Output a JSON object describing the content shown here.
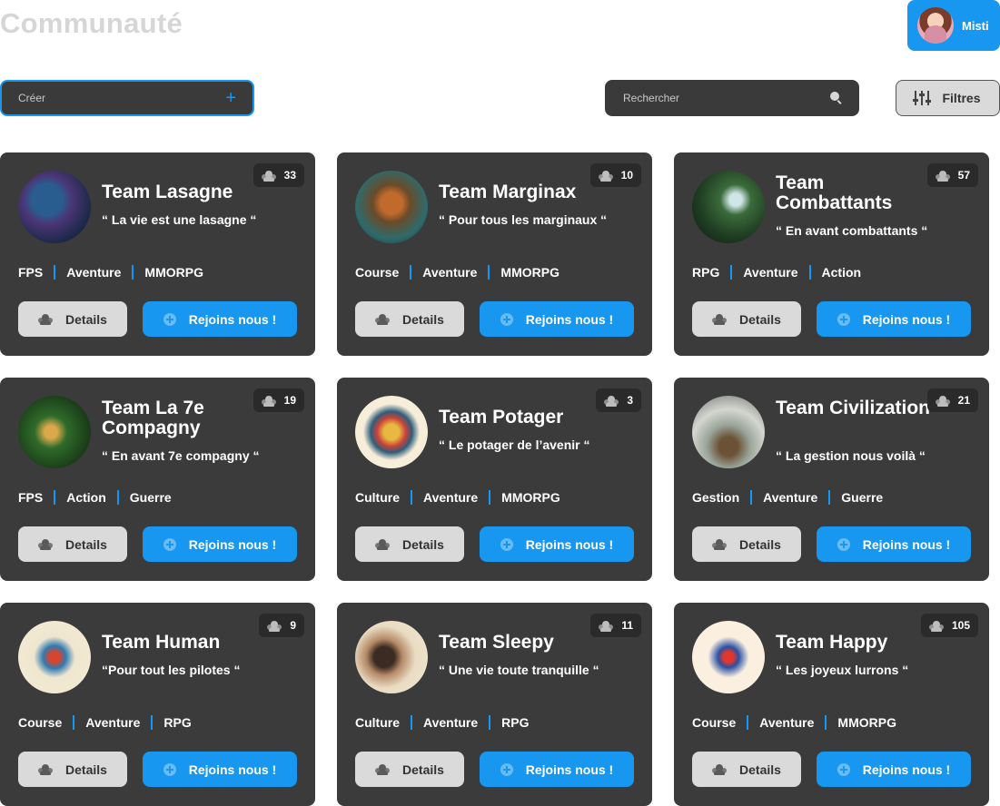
{
  "header": {
    "title": "Communauté"
  },
  "user": {
    "name": "Misti"
  },
  "toolbar": {
    "create_label": "Créer",
    "search_placeholder": "Rechercher",
    "filters_label": "Filtres"
  },
  "card_actions": {
    "details_label": "Details",
    "join_label": "Rejoins nous !"
  },
  "teams": [
    {
      "name": "Team Lasagne",
      "quote": "“ La vie est une lasagne “",
      "members": "33",
      "tags": [
        "FPS",
        "Aventure",
        "MMORPG"
      ]
    },
    {
      "name": "Team Marginax",
      "quote": "“ Pour tous les marginaux “",
      "members": "10",
      "tags": [
        "Course",
        "Aventure",
        "MMORPG"
      ]
    },
    {
      "name": "Team Combattants",
      "quote": "“ En avant combattants “",
      "members": "57",
      "tags": [
        "RPG",
        "Aventure",
        "Action"
      ]
    },
    {
      "name": "Team La 7e Compagny",
      "quote": "“ En avant 7e compagny “",
      "members": "19",
      "tags": [
        "FPS",
        "Action",
        "Guerre"
      ]
    },
    {
      "name": "Team Potager",
      "quote": "“ Le potager de l’avenir “",
      "members": "3",
      "tags": [
        "Culture",
        "Aventure",
        "MMORPG"
      ]
    },
    {
      "name": "Team Civilization",
      "quote": "“ La gestion nous voilà “",
      "members": "21",
      "tags": [
        "Gestion",
        "Aventure",
        "Guerre"
      ]
    },
    {
      "name": "Team Human",
      "quote": "“Pour tout les pilotes “",
      "members": "9",
      "tags": [
        "Course",
        "Aventure",
        "RPG"
      ]
    },
    {
      "name": "Team Sleepy",
      "quote": "“ Une vie toute tranquille “",
      "members": "11",
      "tags": [
        "Culture",
        "Aventure",
        "RPG"
      ]
    },
    {
      "name": "Team Happy",
      "quote": "“ Les joyeux lurrons “",
      "members": "105",
      "tags": [
        "Course",
        "Aventure",
        "MMORPG"
      ]
    }
  ]
}
